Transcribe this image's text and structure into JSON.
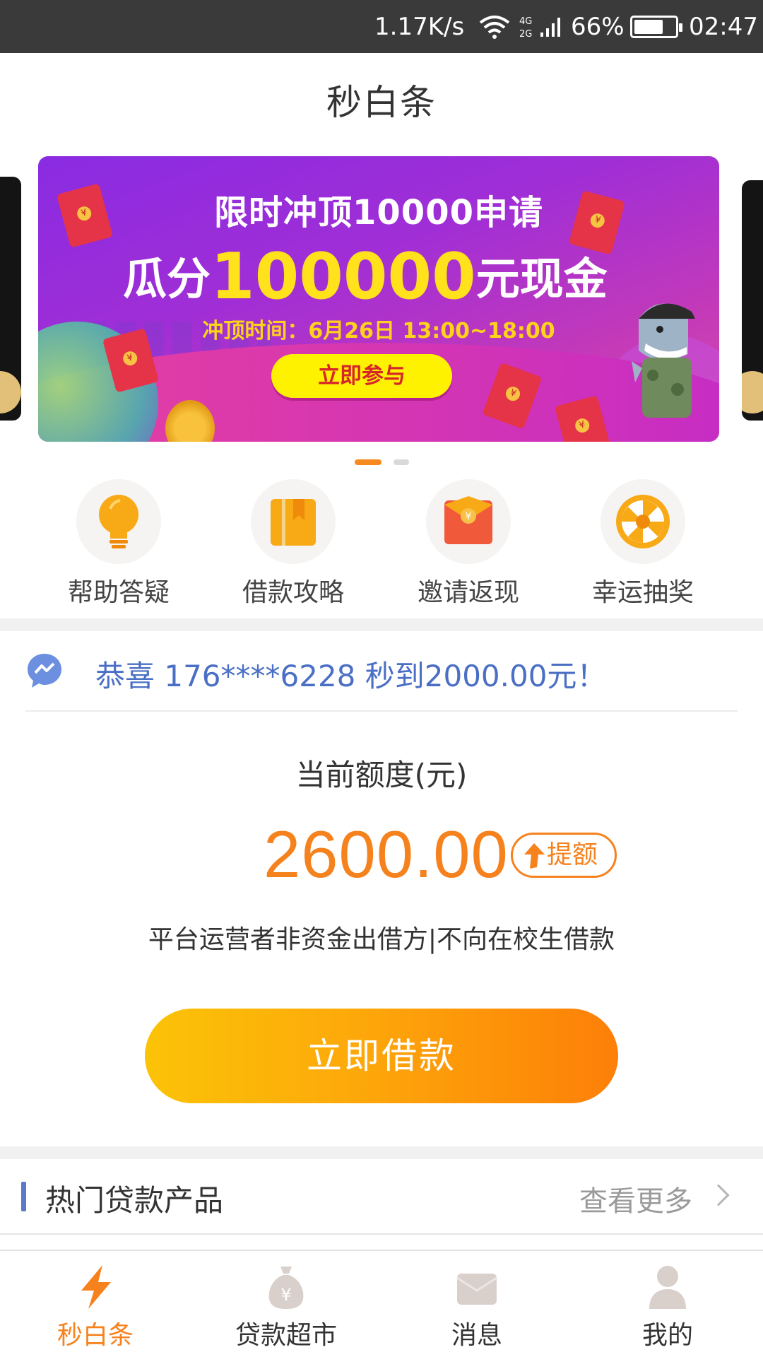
{
  "status_bar": {
    "network_speed": "1.17K/s",
    "network_type": "4G 2G",
    "battery_percent": "66%",
    "time": "02:47",
    "icons": [
      "wifi-icon",
      "signal-icon",
      "battery-icon"
    ]
  },
  "header": {
    "title": "秒白条"
  },
  "banner": {
    "line1": "限时冲顶10000申请",
    "line2_prefix": "瓜分",
    "line2_amount": "100000",
    "line2_suffix": "元现金",
    "line3": "冲顶时间：6月26日 13:00~18:00",
    "cta_label": "立即参与",
    "page_count": 2,
    "active_page": 1
  },
  "quick_menu": [
    {
      "label": "帮助答疑",
      "icon": "lightbulb-icon"
    },
    {
      "label": "借款攻略",
      "icon": "book-icon"
    },
    {
      "label": "邀请返现",
      "icon": "red-envelope-icon"
    },
    {
      "label": "幸运抽奖",
      "icon": "lucky-wheel-icon"
    }
  ],
  "notice": {
    "icon": "message-icon",
    "text": "恭喜 176****6228 秒到2000.00元！"
  },
  "credit": {
    "label": "当前额度(元)",
    "amount": "2600.00",
    "raise_label": "提额",
    "disclaimer": "平台运营者非资金出借方|不向在校生借款"
  },
  "borrow_button": {
    "label": "立即借款"
  },
  "hot_products": {
    "title": "热门贷款产品",
    "see_more_label": "查看更多"
  },
  "bottom_nav": [
    {
      "label": "秒白条",
      "icon": "lightning-icon",
      "active": true
    },
    {
      "label": "贷款超市",
      "icon": "money-bag-icon",
      "active": false
    },
    {
      "label": "消息",
      "icon": "envelope-icon",
      "active": false
    },
    {
      "label": "我的",
      "icon": "user-icon",
      "active": false
    }
  ],
  "colors": {
    "accent_orange": "#f6821e",
    "notice_blue": "#4a6fc5",
    "status_bar_bg": "#3a3a3a",
    "banner_purple": "#a02ed6",
    "cta_yellow": "#fff200"
  }
}
